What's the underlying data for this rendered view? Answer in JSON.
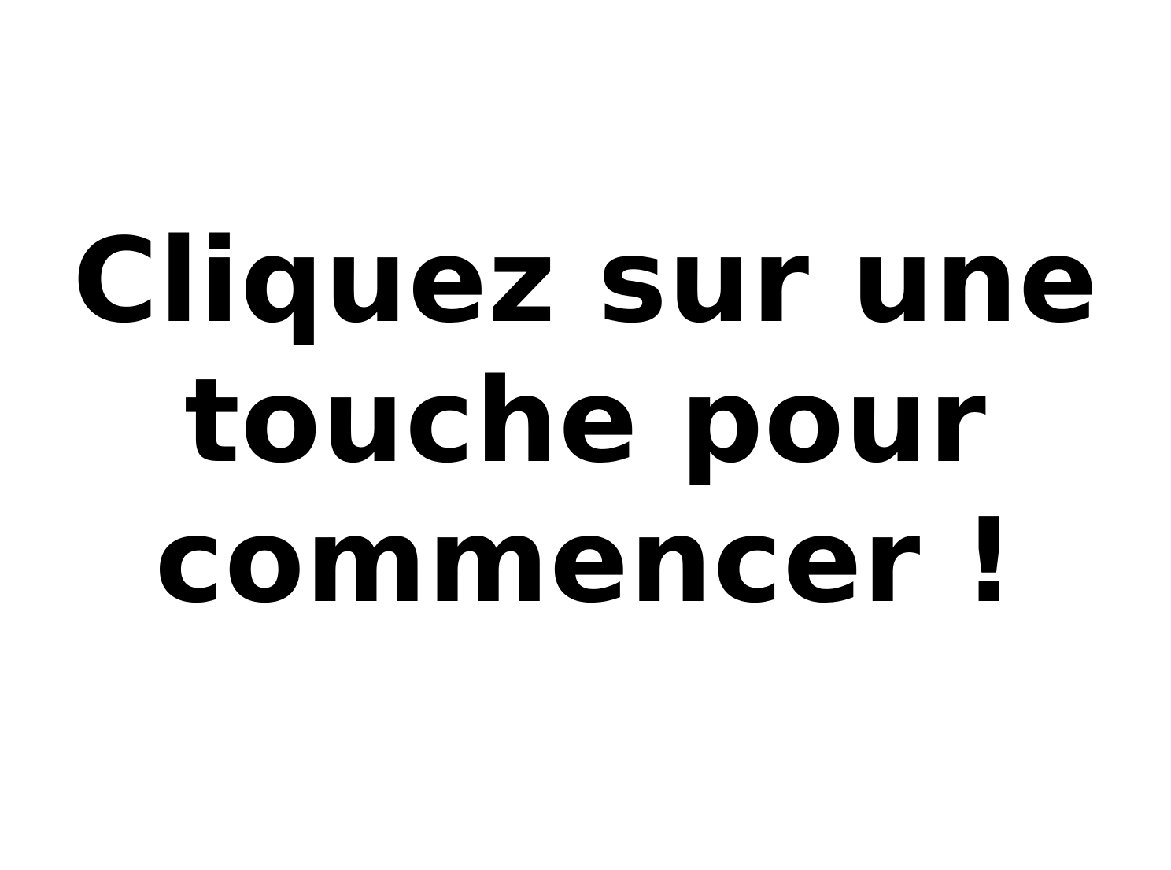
{
  "screen": {
    "background_color": "#ffffff",
    "text_color": "#000000"
  },
  "prompt": {
    "lines": [
      "Cliquez sur une",
      "touche pour",
      "commencer !"
    ]
  }
}
